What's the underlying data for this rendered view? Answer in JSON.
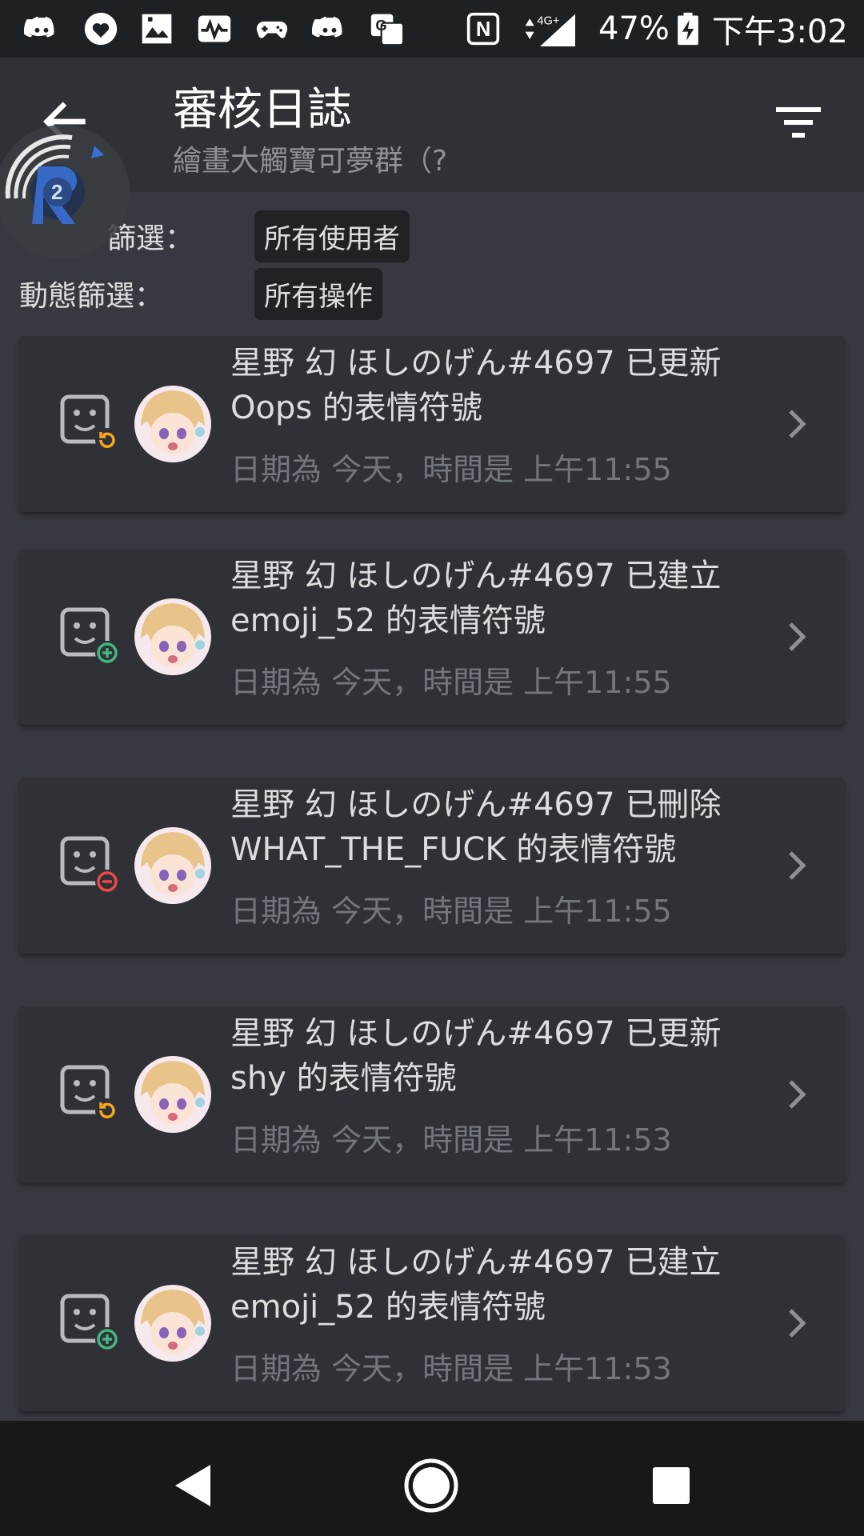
{
  "status_bar": {
    "left_icons": [
      "discord-icon",
      "heart-app-icon",
      "gallery-icon",
      "activity-icon",
      "gamepad-icon",
      "discord-icon",
      "translate-icon"
    ],
    "nfc": "N",
    "network": "4G+",
    "battery": "47%",
    "time": "下午3:02"
  },
  "header": {
    "title": "審核日誌",
    "subtitle": "繪畫大觸寶可夢群（?"
  },
  "filters": {
    "user_label": "篩選：",
    "user_value": "所有使用者",
    "action_label": "動態篩選：",
    "action_value": "所有操作"
  },
  "entries": [
    {
      "type": "update",
      "line1": "星野 幻 ほしのげん#4697 已更新",
      "line2": "Oops 的表情符號",
      "date": "日期為 今天，時間是 上午11:55"
    },
    {
      "type": "create",
      "line1": "星野 幻 ほしのげん#4697 已建立",
      "line2": "emoji_52 的表情符號",
      "date": "日期為 今天，時間是 上午11:55"
    },
    {
      "type": "delete",
      "line1": "星野 幻 ほしのげん#4697 已刪除",
      "line2": "WHAT_THE_FUCK 的表情符號",
      "date": "日期為 今天，時間是 上午11:55"
    },
    {
      "type": "update",
      "line1": "星野 幻 ほしのげん#4697 已更新",
      "line2": "shy 的表情符號",
      "date": "日期為 今天，時間是 上午11:53"
    },
    {
      "type": "create",
      "line1": "星野 幻 ほしのげん#4697 已建立",
      "line2": "emoji_52 的表情符號",
      "date": "日期為 今天，時間是 上午11:53"
    }
  ],
  "colors": {
    "update": "#faa61a",
    "create": "#43b581",
    "delete": "#f04747"
  }
}
